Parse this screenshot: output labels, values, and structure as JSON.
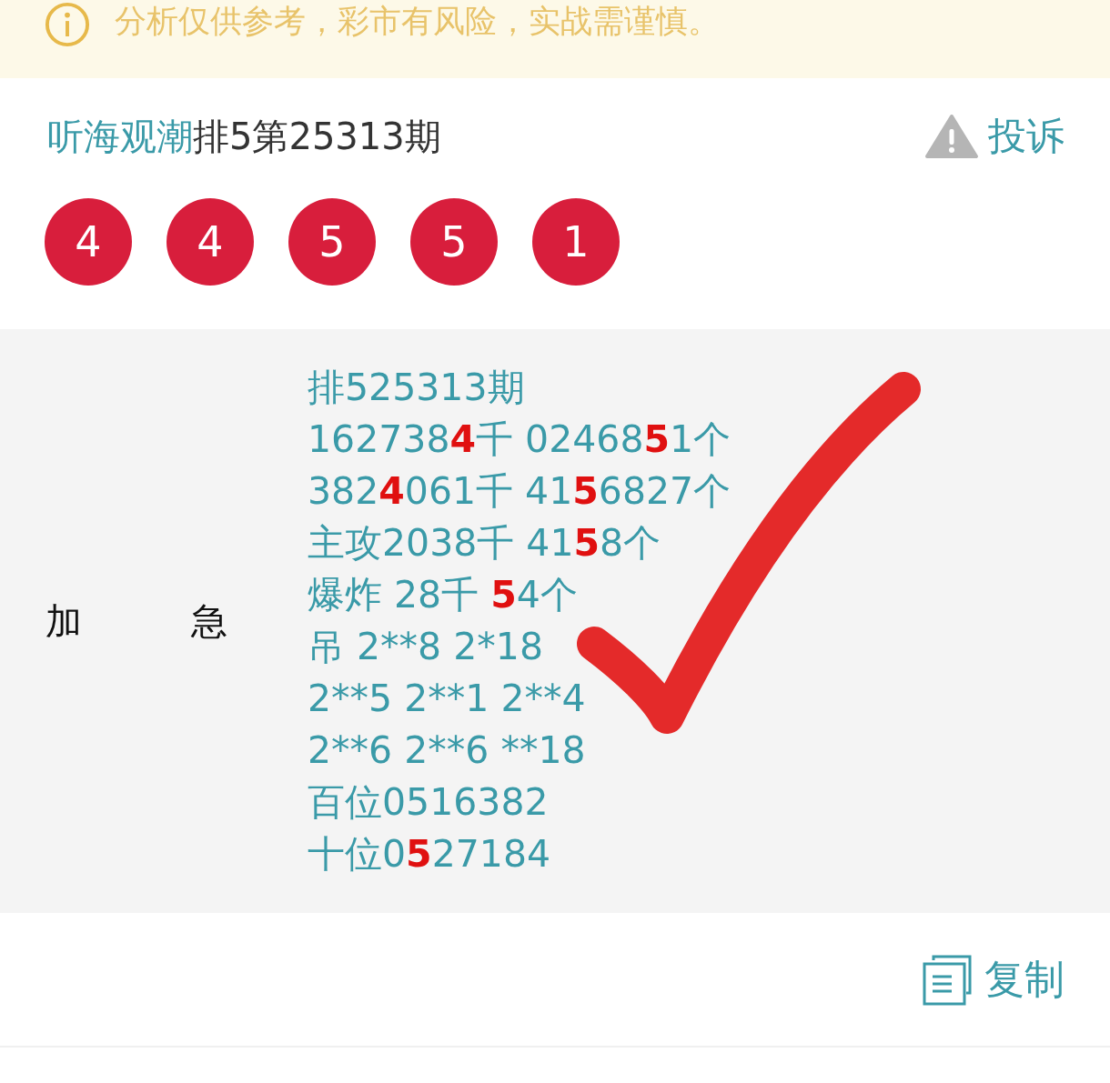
{
  "notice": {
    "text": "分析仅供参考，彩市有风险，实战需谨慎。"
  },
  "header": {
    "author": "听海观潮",
    "title": "排5第25313期",
    "report": "投诉"
  },
  "balls": [
    "4",
    "4",
    "5",
    "5",
    "1"
  ],
  "post": {
    "label": "加　　　急",
    "lines": [
      "排525313期",
      "162738**4**千 02468**5**1个",
      "382**4**061千 41**5**6827个",
      "主攻2038千 41**5**8个",
      "爆炸 28千 **5**4个",
      "吊 2**8 2*18",
      "2**5 2**1 2**4",
      "2**6 2**6 **18",
      "百位0516382",
      "十位0**5**27184"
    ],
    "checked": true
  },
  "copy": {
    "label": "复制"
  }
}
